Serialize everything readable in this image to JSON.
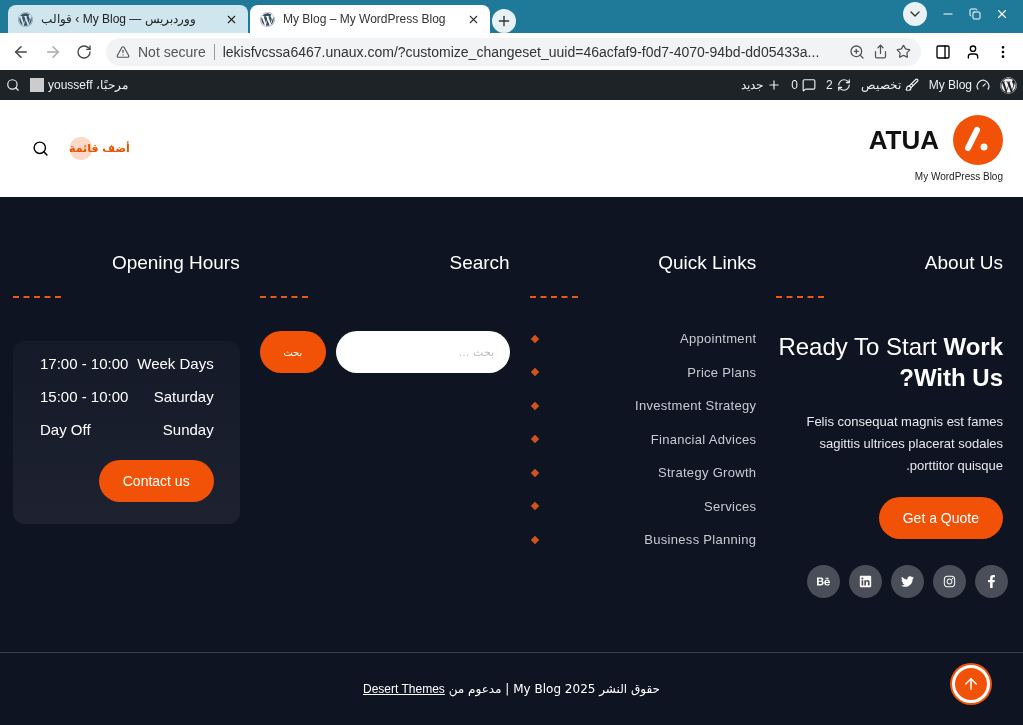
{
  "browser": {
    "tabs": [
      {
        "title": "قوالب ‹ My Blog — ووردبريس",
        "selected": false
      },
      {
        "title": "My Blog – My WordPress Blog",
        "selected": true
      }
    ],
    "security": "Not secure",
    "url": "lekisfvcssa6467.unaux.com/?customize_changeset_uuid=46acfaf9-f0d7-4070-94bd-dd05433a..."
  },
  "admin_bar": {
    "site": "My Blog",
    "customize": "تخصيص",
    "updates": "2",
    "comments": "0",
    "new": "جديد",
    "greeting": "مرحبًا، yousseff"
  },
  "header": {
    "logo": "ATUA",
    "tagline": "My WordPress Blog",
    "menu_link": "أضف قائمة"
  },
  "footer": {
    "about": {
      "title": "About Us",
      "headline": "Ready To Start **Work ?With Us**",
      "text": "Felis consequat magnis est fames sagittis ultrices placerat sodales .porttitor quisque",
      "button": "Get a Quote"
    },
    "quick_links": {
      "title": "Quick Links",
      "items": [
        "Appointment",
        "Price Plans",
        "Investment Strategy",
        "Financial Advices",
        "Strategy Growth",
        "Services",
        "Business Planning"
      ]
    },
    "search": {
      "title": "Search",
      "placeholder": "بحث …",
      "button": "بحث"
    },
    "hours": {
      "title": "Opening Hours",
      "rows": [
        {
          "day": "Week Days",
          "time": "17:00 - 10:00"
        },
        {
          "day": "Saturday",
          "time": "15:00 - 10:00"
        },
        {
          "day": "Sunday",
          "time": "Day Off"
        }
      ],
      "button": "Contact us"
    },
    "copyright": "حقوق النشر 2025 My Blog | مدعوم من",
    "credit_link": "Desert Themes"
  }
}
